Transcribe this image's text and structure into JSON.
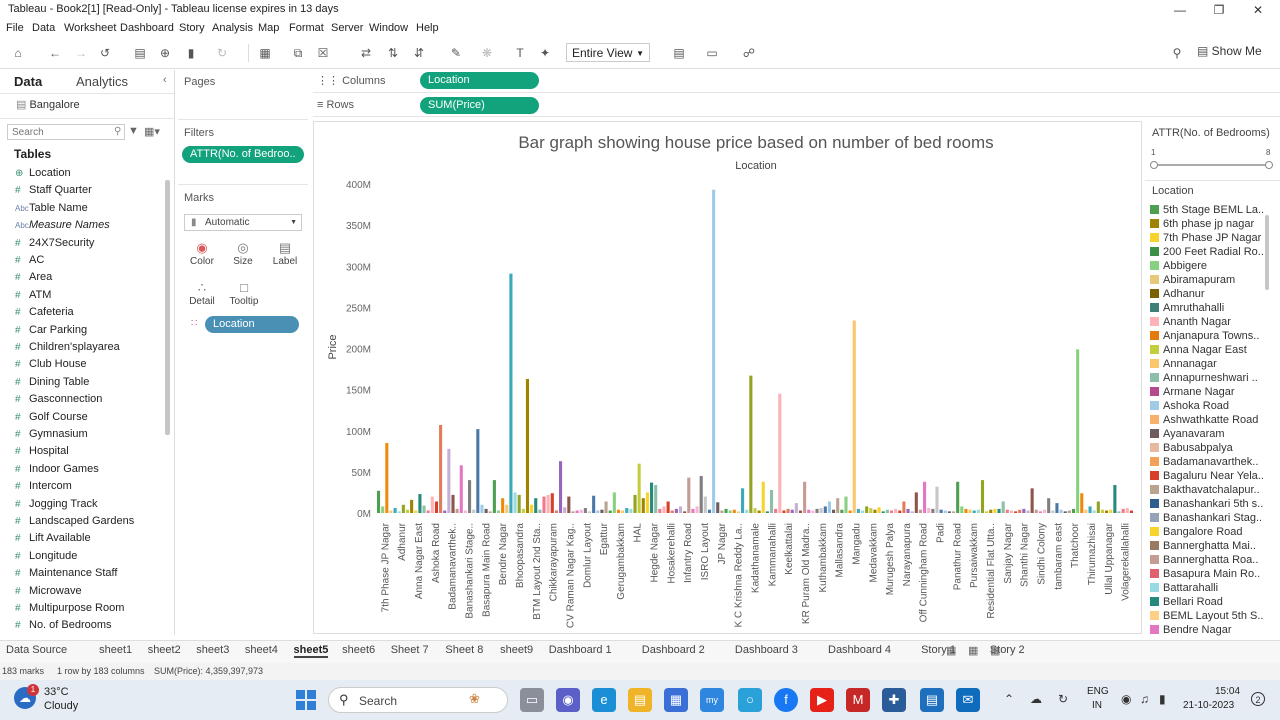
{
  "window": {
    "title": "Tableau - Book2[1] [Read-Only] - Tableau license expires in 13 days"
  },
  "menu": [
    "File",
    "Data",
    "Worksheet",
    "Dashboard",
    "Story",
    "Analysis",
    "Map",
    "Format",
    "Server",
    "Window",
    "Help"
  ],
  "toolbar": {
    "fit": "Entire View",
    "show_me": "Show Me"
  },
  "left": {
    "tab_data": "Data",
    "tab_analytics": "Analytics",
    "datasource": "Bangalore",
    "search_placeholder": "Search",
    "tables_heading": "Tables",
    "fields": [
      {
        "label": "Location",
        "icon": "globe-icon",
        "type": "geo"
      },
      {
        "label": "Staff Quarter",
        "icon": "number-icon",
        "type": "num"
      },
      {
        "label": "Table Name",
        "icon": "abc-icon",
        "type": "str"
      },
      {
        "label": "Measure Names",
        "icon": "abc-icon",
        "type": "str",
        "italic": true
      },
      {
        "label": "24X7Security",
        "icon": "number-icon",
        "type": "num"
      },
      {
        "label": "AC",
        "icon": "number-icon",
        "type": "num"
      },
      {
        "label": "Area",
        "icon": "number-icon",
        "type": "num"
      },
      {
        "label": "ATM",
        "icon": "number-icon",
        "type": "num"
      },
      {
        "label": "Cafeteria",
        "icon": "number-icon",
        "type": "num"
      },
      {
        "label": "Car Parking",
        "icon": "number-icon",
        "type": "num"
      },
      {
        "label": "Children'splayarea",
        "icon": "number-icon",
        "type": "num"
      },
      {
        "label": "Club House",
        "icon": "number-icon",
        "type": "num"
      },
      {
        "label": "Dining Table",
        "icon": "number-icon",
        "type": "num"
      },
      {
        "label": "Gasconnection",
        "icon": "number-icon",
        "type": "num"
      },
      {
        "label": "Golf Course",
        "icon": "number-icon",
        "type": "num"
      },
      {
        "label": "Gymnasium",
        "icon": "number-icon",
        "type": "num"
      },
      {
        "label": "Hospital",
        "icon": "number-icon",
        "type": "num"
      },
      {
        "label": "Indoor Games",
        "icon": "number-icon",
        "type": "num"
      },
      {
        "label": "Intercom",
        "icon": "number-icon",
        "type": "num"
      },
      {
        "label": "Jogging Track",
        "icon": "number-icon",
        "type": "num"
      },
      {
        "label": "Landscaped Gardens",
        "icon": "number-icon",
        "type": "num"
      },
      {
        "label": "Lift Available",
        "icon": "number-icon",
        "type": "num"
      },
      {
        "label": "Longitude",
        "icon": "number-icon",
        "type": "num"
      },
      {
        "label": "Maintenance Staff",
        "icon": "number-icon",
        "type": "num"
      },
      {
        "label": "Microwave",
        "icon": "number-icon",
        "type": "num"
      },
      {
        "label": "Multipurpose Room",
        "icon": "number-icon",
        "type": "num"
      },
      {
        "label": "No. of Bedrooms",
        "icon": "number-icon",
        "type": "num"
      }
    ]
  },
  "shelves": {
    "pages": "Pages",
    "filters": "Filters",
    "filter_pill": "ATTR(No. of Bedroo..",
    "marks": "Marks",
    "mark_type": "Automatic",
    "mark_buttons": [
      "Color",
      "Size",
      "Label",
      "Detail",
      "Tooltip"
    ],
    "mark_pill": "Location",
    "columns_label": "Columns",
    "columns_pill": "Location",
    "rows_label": "Rows",
    "rows_pill": "SUM(Price)"
  },
  "chart_data": {
    "type": "bar",
    "title": "Bar graph showing house price based on number of bed rooms",
    "column_header": "Location",
    "ylabel": "Price",
    "ylim": [
      0,
      400
    ],
    "yunit": "M",
    "yticks": [
      "0M",
      "50M",
      "100M",
      "150M",
      "200M",
      "250M",
      "300M",
      "350M",
      "400M"
    ],
    "grid": false,
    "x_tick_labels": [
      "7th Phase JP Nagar",
      "Adhanur",
      "Anna Nagar East",
      "Ashoka Road",
      "Badamanavarthek..",
      "Banashankari Stage..",
      "Basapura Main Road",
      "Bendre Nagar",
      "Bhoopasandra",
      "BTM Layout 2nd Sta..",
      "Chikkarayapuram",
      "CV Raman Nagar Kag..",
      "Domlur Layout",
      "Egattur",
      "Gerugambakkam",
      "HAL",
      "Hegde Nagar",
      "Hosakerehalli",
      "Infantry Road",
      "ISRO Layout",
      "JP Nagar",
      "K C Krishna Reddy La..",
      "Kadathanamale",
      "Kammanahalli",
      "Keelkattalai",
      "KR Puram Old Madra..",
      "Kuthambakkam",
      "Mallasandra",
      "Mangadu",
      "Medavakkam",
      "Murugesh Palya",
      "Narayanapura",
      "Off Cunningham Road",
      "Padi",
      "Panathur Road",
      "Pursaiwakkam",
      "Residential Flat Utta..",
      "Sanjay Nagar",
      "Shanthi Nagar",
      "Sindhi Colony",
      "tambaram east",
      "Thatchoor",
      "Thirumazhisai",
      "Ullal Uppanagar",
      "Volagerekallahalli"
    ],
    "bars_count": 183,
    "values": [
      27,
      8,
      85,
      3,
      6,
      2,
      10,
      4,
      16,
      3,
      23,
      9,
      3,
      20,
      14,
      107,
      3,
      78,
      22,
      5,
      58,
      3,
      40,
      4,
      102,
      10,
      5,
      2,
      40,
      3,
      18,
      10,
      291,
      25,
      22,
      5,
      163,
      10,
      18,
      4,
      20,
      22,
      24,
      3,
      63,
      7,
      20,
      2,
      3,
      4,
      6,
      2,
      21,
      3,
      4,
      14,
      3,
      25,
      4,
      3,
      6,
      5,
      22,
      60,
      18,
      25,
      37,
      34,
      5,
      8,
      14,
      3,
      5,
      8,
      2,
      43,
      5,
      8,
      45,
      20,
      4,
      393,
      13,
      3,
      5,
      3,
      4,
      2,
      30,
      4,
      167,
      6,
      3,
      38,
      2,
      28,
      5,
      145,
      3,
      5,
      4,
      12,
      3,
      38,
      4,
      3,
      5,
      6,
      8,
      14,
      4,
      18,
      4,
      20,
      3,
      234,
      5,
      3,
      8,
      6,
      4,
      7,
      2,
      4,
      3,
      5,
      3,
      14,
      5,
      2,
      25,
      4,
      38,
      6,
      5,
      32,
      4,
      3,
      2,
      2,
      38,
      8,
      5,
      4,
      3,
      4,
      40,
      2,
      4,
      5,
      5,
      14,
      4,
      3,
      2,
      4,
      5,
      3,
      30,
      4,
      2,
      4,
      18,
      3,
      12,
      4,
      2,
      3,
      5,
      199,
      24,
      4,
      8,
      3,
      14,
      4,
      3,
      4,
      34,
      2,
      5,
      6,
      3
    ],
    "palette": [
      "#4e9f50",
      "#87d180",
      "#ef8a0c",
      "#fcc66d",
      "#3ca8bc",
      "#98d9e4",
      "#94a323",
      "#c3ce3d",
      "#a08400",
      "#f7d42d",
      "#26897e",
      "#8dbfa8",
      "#f1788d",
      "#ffb2b6",
      "#d63f2a",
      "#e07c5a",
      "#9467bd",
      "#c5b0d5",
      "#8c564b",
      "#c49c94",
      "#e377c2",
      "#f7b6d2",
      "#7f7f7f",
      "#c7c7c7",
      "#4a78a8",
      "#a0cbe8",
      "#6e5b5b",
      "#b9a58f"
    ],
    "legend_title": "ATTR(No. of Bedrooms)",
    "legend_range": [
      "1",
      "8"
    ]
  },
  "legend": {
    "title": "Location",
    "items": [
      {
        "label": "5th Stage BEML La..",
        "color": "#4e9f50"
      },
      {
        "label": "6th phase jp nagar",
        "color": "#a08400"
      },
      {
        "label": "7th Phase JP Nagar",
        "color": "#f7d42d"
      },
      {
        "label": "200 Feet Radial Ro..",
        "color": "#3d8f48"
      },
      {
        "label": "Abbigere",
        "color": "#87d180"
      },
      {
        "label": "Abiramapuram",
        "color": "#e8c87a"
      },
      {
        "label": "Adhanur",
        "color": "#7a6200"
      },
      {
        "label": "Amruthahalli",
        "color": "#3e7f7a"
      },
      {
        "label": "Ananth Nagar",
        "color": "#ffb2b6"
      },
      {
        "label": "Anjanapura Towns..",
        "color": "#e07b0c"
      },
      {
        "label": "Anna Nagar East",
        "color": "#c3ce3d"
      },
      {
        "label": "Annanagar",
        "color": "#fcc66d"
      },
      {
        "label": "Annapurneshwari ..",
        "color": "#8dbfa8"
      },
      {
        "label": "Armane Nagar",
        "color": "#b54b8e"
      },
      {
        "label": "Ashoka Road",
        "color": "#a0cbe8"
      },
      {
        "label": "Ashwathkatte Road",
        "color": "#f8b16a"
      },
      {
        "label": "Ayanavaram",
        "color": "#6e5b5b"
      },
      {
        "label": "Babusabpalya",
        "color": "#e8b8a0"
      },
      {
        "label": "Badamanavarthek..",
        "color": "#f3a05a"
      },
      {
        "label": "Bagaluru Near Yela..",
        "color": "#d63f2a"
      },
      {
        "label": "Bakthavatchalapur..",
        "color": "#b9a58f"
      },
      {
        "label": "Banashankari 5th s..",
        "color": "#2f5e8e"
      },
      {
        "label": "Banashankari Stag..",
        "color": "#94a3b8"
      },
      {
        "label": "Bangalore Road",
        "color": "#f7d42d"
      },
      {
        "label": "Bannerghatta Mai..",
        "color": "#9a7a60"
      },
      {
        "label": "Bannerghatta Roa..",
        "color": "#c49c94"
      },
      {
        "label": "Basapura Main Ro..",
        "color": "#e06070"
      },
      {
        "label": "Battarahalli",
        "color": "#98d9e4"
      },
      {
        "label": "Bellari Road",
        "color": "#26897e"
      },
      {
        "label": "BEML Layout 5th S..",
        "color": "#ffcf85"
      },
      {
        "label": "Bendre Nagar",
        "color": "#e377c2"
      }
    ]
  },
  "sheet_tabs": [
    "Data Source",
    "sheet1",
    "sheet2",
    "sheet3",
    "sheet4",
    "sheet5",
    "sheet6",
    "Sheet 7",
    "Sheet 8",
    "sheet9",
    "Dashboard 1",
    "Dashboard 2",
    "Dashboard 3",
    "Dashboard 4",
    "Story 1",
    "Story 2"
  ],
  "active_tab": "sheet5",
  "status": {
    "marks": "183 marks",
    "dims": "1 row by 183 columns",
    "sum": "SUM(Price): 4,359,397,973"
  },
  "taskbar": {
    "weather_temp": "33°C",
    "weather_desc": "Cloudy",
    "search": "Search",
    "lang1": "ENG",
    "lang2": "IN",
    "time": "15:04",
    "date": "21-10-2023",
    "notif_count": "2",
    "weather_badge": "1"
  }
}
